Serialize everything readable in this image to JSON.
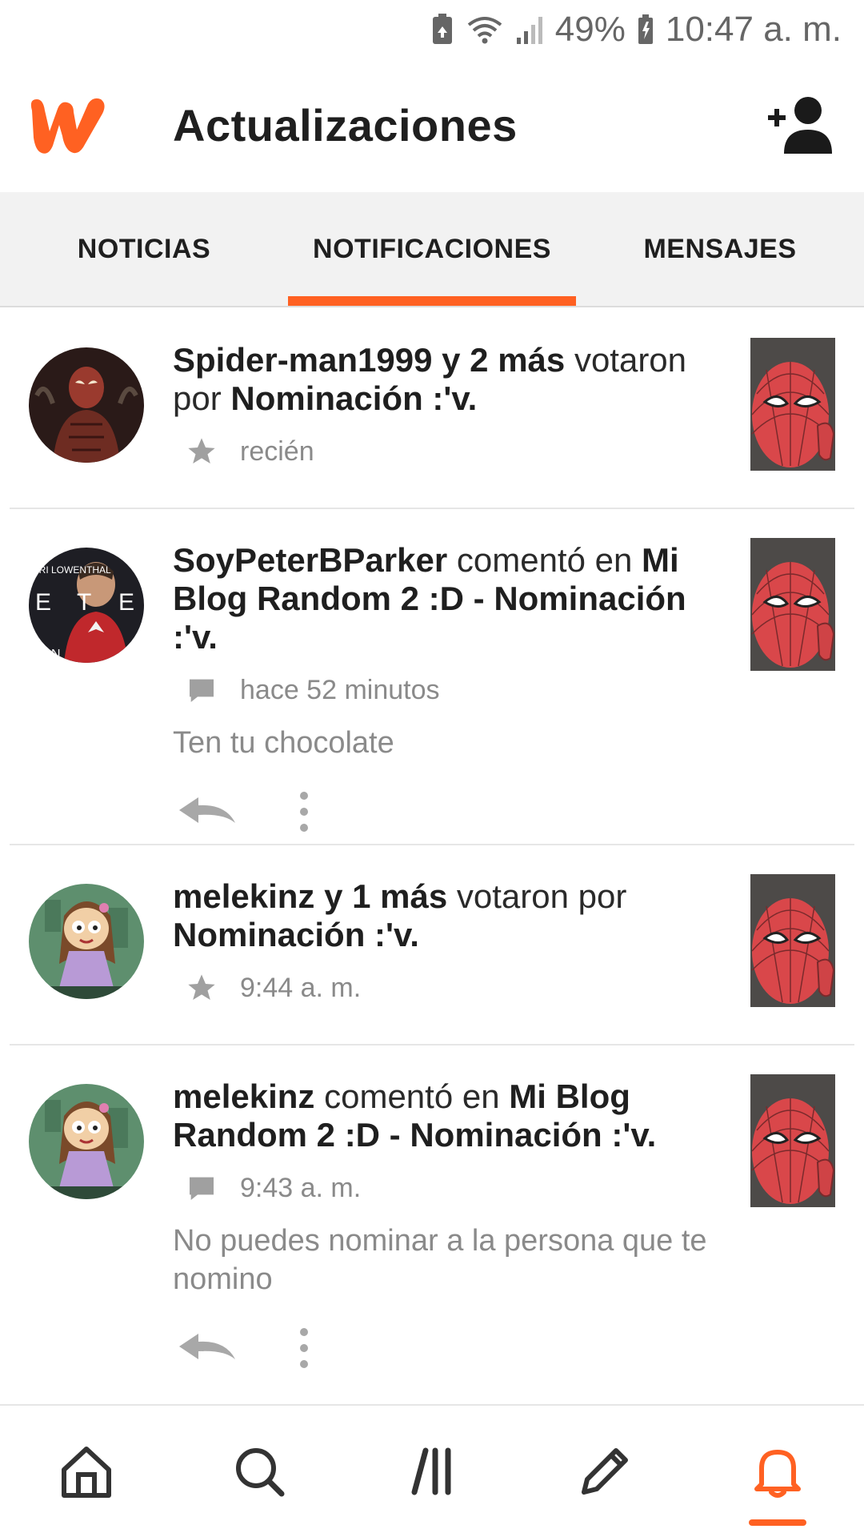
{
  "status_bar": {
    "battery_percent": "49%",
    "time": "10:47 a. m.",
    "icons": [
      "battery-saver-icon",
      "wifi-icon",
      "signal-icon",
      "battery-icon"
    ]
  },
  "app_bar": {
    "title": "Actualizaciones",
    "logo_icon": "wattpad-logo",
    "add_friend_icon": "add-person-icon",
    "brand_color": "#ff6122"
  },
  "tabs": [
    {
      "label": "NOTICIAS",
      "active": false
    },
    {
      "label": "NOTIFICACIONES",
      "active": true
    },
    {
      "label": "MENSAJES",
      "active": false
    }
  ],
  "notifications": [
    {
      "actor": "Spider-man1999 y 2 más",
      "verb": "votaron por",
      "target": "Nominación :'v.",
      "meta_icon": "star-icon",
      "time": "recién",
      "comment": "",
      "avatar": "spider-man-avatar"
    },
    {
      "actor": "SoyPeterBParker",
      "verb": "comentó en",
      "target": "Mi Blog Random 2 :D - Nominación :'v.",
      "meta_icon": "comment-icon",
      "time": "hace 52 minutos",
      "comment": "Ten tu chocolate",
      "avatar": "peter-parker-avatar"
    },
    {
      "actor": "melekinz y 1 más",
      "verb": "votaron por",
      "target": "Nominación :'v.",
      "meta_icon": "star-icon",
      "time": "9:44 a. m.",
      "comment": "",
      "avatar": "cartoon-girl-avatar"
    },
    {
      "actor": "melekinz",
      "verb": "comentó en",
      "target": "Mi Blog Random 2 :D - Nominación :'v.",
      "meta_icon": "comment-icon",
      "time": "9:43 a. m.",
      "comment": "No puedes nominar a la persona que te nomino",
      "avatar": "cartoon-girl-avatar"
    }
  ],
  "bottom_nav": [
    {
      "icon": "home-icon",
      "active": false
    },
    {
      "icon": "search-icon",
      "active": false
    },
    {
      "icon": "library-icon",
      "active": false
    },
    {
      "icon": "write-icon",
      "active": false
    },
    {
      "icon": "notifications-bell-icon",
      "active": true
    }
  ]
}
